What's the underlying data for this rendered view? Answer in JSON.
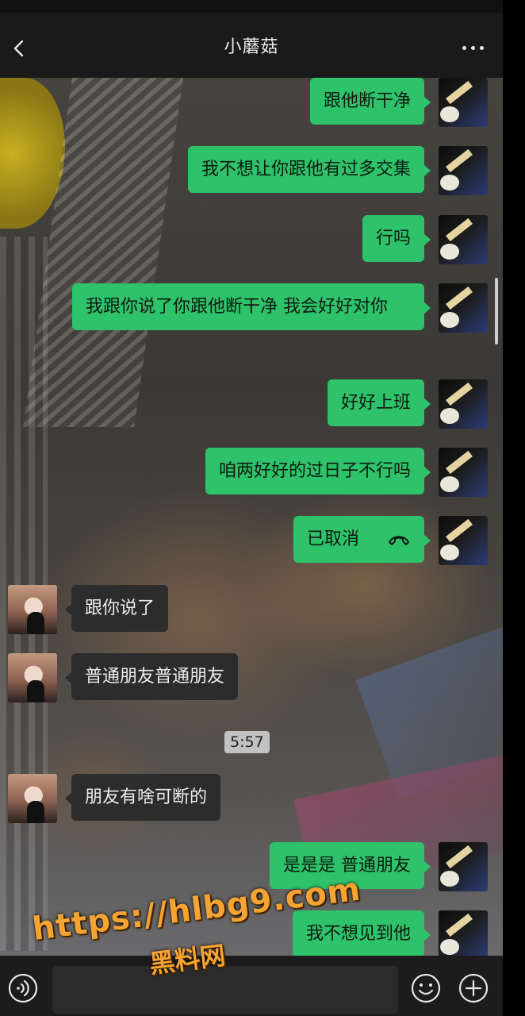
{
  "header": {
    "title": "小蘑菇"
  },
  "messages": [
    {
      "side": "out",
      "text": "跟他断干净"
    },
    {
      "side": "out",
      "text": "我不想让你跟他有过多交集"
    },
    {
      "side": "out",
      "text": "行吗"
    },
    {
      "side": "out",
      "text": "我跟你说了你跟他断干净 我会好好对你"
    },
    {
      "side": "out",
      "text": "好好上班"
    },
    {
      "side": "out",
      "text": "咱两好好的过日子不行吗"
    },
    {
      "side": "out",
      "text": "已取消",
      "type": "voice-call"
    },
    {
      "side": "in",
      "text": "跟你说了"
    },
    {
      "side": "in",
      "text": "普通朋友普通朋友"
    },
    {
      "side": "in",
      "text": "朋友有啥可断的"
    },
    {
      "side": "out",
      "text": "是是是 普通朋友"
    },
    {
      "side": "out",
      "text": "我不想见到他"
    }
  ],
  "timestamp": "5:57",
  "watermark": {
    "url": "https://hlbg9.com",
    "name": "黑料网"
  },
  "colors": {
    "outgoing_bubble": "#2ec26a",
    "incoming_bubble": "#2c2c2c",
    "header": "#1a1a1a"
  },
  "icons": [
    "back-icon",
    "more-icon",
    "voice-icon",
    "emoji-icon",
    "plus-icon",
    "phone-hangup-icon"
  ]
}
